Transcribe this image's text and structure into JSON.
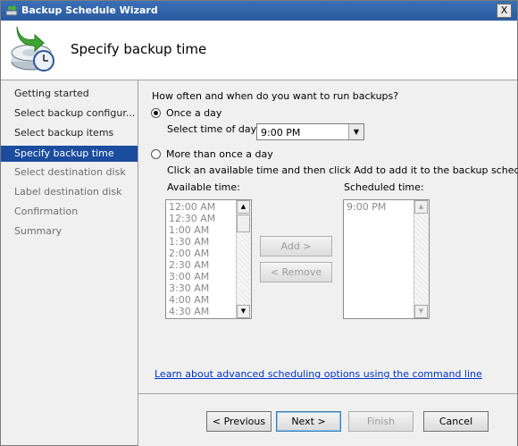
{
  "window": {
    "title": "Backup Schedule Wizard",
    "close_label": "X"
  },
  "header": {
    "title": "Specify backup time",
    "icon": "backup-wizard-icon"
  },
  "sidebar": {
    "items": [
      {
        "label": "Getting started",
        "state": "done"
      },
      {
        "label": "Select backup configur...",
        "state": "done"
      },
      {
        "label": "Select backup items",
        "state": "done"
      },
      {
        "label": "Specify backup time",
        "state": "active"
      },
      {
        "label": "Select destination disk",
        "state": "future"
      },
      {
        "label": "Label destination disk",
        "state": "future"
      },
      {
        "label": "Confirmation",
        "state": "future"
      },
      {
        "label": "Summary",
        "state": "future"
      }
    ]
  },
  "main": {
    "question": "How often and when do you want to run backups?",
    "once": {
      "label": "Once a day",
      "checked": true
    },
    "time_label": "Select time of day:",
    "time_value": "9:00 PM",
    "multi": {
      "label": "More than once a day",
      "checked": false
    },
    "instruction": "Click an available time and then click Add to add it to the backup schedule.",
    "available_label": "Available time:",
    "available": [
      "12:00 AM",
      "12:30 AM",
      "1:00 AM",
      "1:30 AM",
      "2:00 AM",
      "2:30 AM",
      "3:00 AM",
      "3:30 AM",
      "4:00 AM",
      "4:30 AM"
    ],
    "scheduled_label": "Scheduled time:",
    "scheduled": [
      "9:00 PM"
    ],
    "add_label": "Add >",
    "remove_label": "< Remove",
    "link": "Learn about advanced scheduling options using the command line"
  },
  "footer": {
    "previous": "< Previous",
    "next": "Next >",
    "finish": "Finish",
    "cancel": "Cancel"
  },
  "colors": {
    "titlebar": "#2a5aa0",
    "active_step": "#1b4c9e",
    "link": "#0033cc"
  }
}
